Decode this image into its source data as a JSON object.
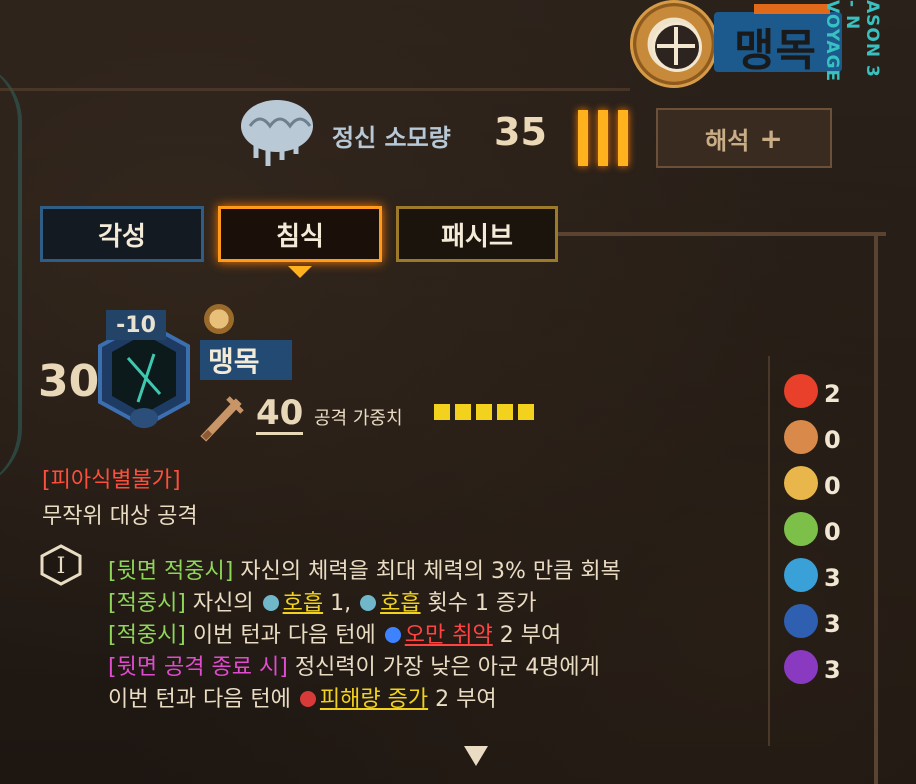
{
  "sinner": {
    "name": "맹목",
    "season_text": "ASON 3 - N VOYAGE"
  },
  "sanity": {
    "label": "정신 소모량",
    "value": "35"
  },
  "interpret_button": {
    "label": "해석",
    "plus": "+"
  },
  "tabs": [
    {
      "label": "각성",
      "active": false
    },
    {
      "label": "침식",
      "active": true
    },
    {
      "label": "패시브",
      "active": false
    }
  ],
  "skill": {
    "base_power": "30",
    "coin_modifier": "-10",
    "name": "맹목",
    "attack_level": "40",
    "attack_weight_label": "공격 가중치",
    "attack_weight": 5,
    "tag": "[피아식별불가]",
    "sub_desc": "무작위 대상 공격",
    "coin_number": "I"
  },
  "coin_effects": {
    "line1": {
      "trigger": "[뒷면 적중시]",
      "text": " 자신의 체력을 최대 체력의 3% 만큼 회복"
    },
    "line2": {
      "trigger": "[적중시]",
      "a": " 자신의 ",
      "kw1": "호흡",
      "b": " 1, ",
      "kw2": "호흡",
      "c": " 횟수 1 증가"
    },
    "line3": {
      "trigger": "[적중시]",
      "a": " 이번 턴과 다음 턴에 ",
      "kw": "오만 취약",
      "b": " 2 부여"
    },
    "line4": {
      "trigger": "[뒷면 공격 종료 시]",
      "text": " 정신력이 가장 낮은 아군 4명에게"
    },
    "line5": {
      "a": "이번 턴과 다음 턴에 ",
      "kw": "피해량 증가",
      "b": " 2 부여"
    }
  },
  "sin_affinities": [
    {
      "icon": "wrath-icon",
      "color": "#e8402a",
      "value": "2"
    },
    {
      "icon": "lust-icon",
      "color": "#d98a4a",
      "value": "0"
    },
    {
      "icon": "sloth-icon",
      "color": "#e8b64a",
      "value": "0"
    },
    {
      "icon": "gluttony-icon",
      "color": "#7cc04a",
      "value": "0"
    },
    {
      "icon": "gloom-icon",
      "color": "#3aa0d8",
      "value": "3"
    },
    {
      "icon": "pride-icon",
      "color": "#2f5fb0",
      "value": "3"
    },
    {
      "icon": "envy-icon",
      "color": "#8a3ac0",
      "value": "3"
    }
  ]
}
